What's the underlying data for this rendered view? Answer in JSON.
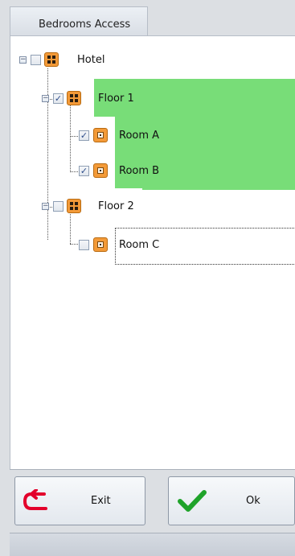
{
  "tab": {
    "title": "Bedrooms Access"
  },
  "tree": {
    "hotel": {
      "label": "Hotel",
      "checked": false,
      "expander": "−"
    },
    "floor1": {
      "label": "Floor 1",
      "checked": true,
      "expander": "−"
    },
    "room_a": {
      "label": "Room A",
      "checked": true
    },
    "room_b": {
      "label": "Room B",
      "checked": true
    },
    "floor2": {
      "label": "Floor 2",
      "checked": false,
      "expander": "−"
    },
    "room_c": {
      "label": "Room C",
      "checked": false
    }
  },
  "buttons": {
    "exit": {
      "label": "Exit"
    },
    "ok": {
      "label": "Ok"
    }
  },
  "colors": {
    "selected_row": "#78dd78",
    "node_icon": "#f39a38",
    "exit_icon": "#e3002b",
    "ok_icon": "#1fa32a"
  },
  "icons": {
    "group": "grid-icon",
    "room": "room-icon",
    "exit": "undo-arrow-icon",
    "ok": "checkmark-icon"
  }
}
